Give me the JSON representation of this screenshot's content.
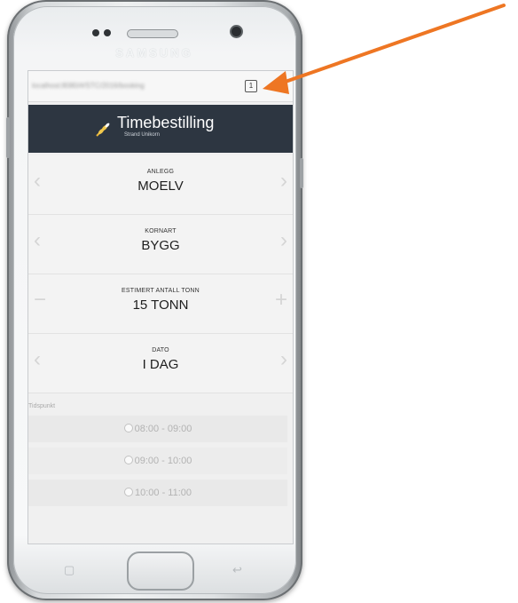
{
  "device": {
    "brand": "SAMSUNG"
  },
  "browser": {
    "url": "localhost:8080/#/STC/2016/booking"
  },
  "app": {
    "title": "Timebestilling",
    "subtitle": "Strand Unikorn"
  },
  "selectors": [
    {
      "label": "ANLEGG",
      "value": "MOELV",
      "left_icon": "chevron-left-icon",
      "right_icon": "chevron-right-icon"
    },
    {
      "label": "KORNART",
      "value": "BYGG",
      "left_icon": "chevron-left-icon",
      "right_icon": "chevron-right-icon"
    },
    {
      "label": "ESTIMERT ANTALL TONN",
      "value": "15 TONN",
      "left_icon": "minus-icon",
      "right_icon": "plus-icon"
    },
    {
      "label": "DATO",
      "value": "I DAG",
      "left_icon": "chevron-left-icon",
      "right_icon": "chevron-right-icon"
    }
  ],
  "timeslots": {
    "label": "Tidspunkt",
    "options": [
      "08:00 - 09:00",
      "09:00 - 10:00",
      "10:00 - 11:00"
    ]
  },
  "annotation": {
    "color": "#ee7623"
  },
  "colors": {
    "header_bg": "#2d3641",
    "screen_bg": "#f0f0f0"
  }
}
